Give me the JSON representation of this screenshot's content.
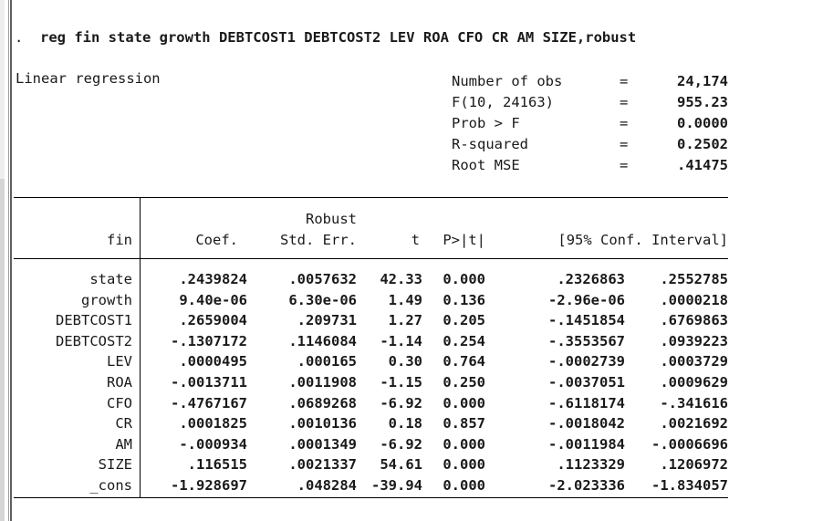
{
  "command": {
    "prompt": ".",
    "text": "reg fin state growth DEBTCOST1 DEBTCOST2 LEV ROA CFO CR AM SIZE,robust"
  },
  "model": {
    "type_label": "Linear regression"
  },
  "stats": [
    {
      "label": "Number of obs",
      "eq": "=",
      "value": "24,174"
    },
    {
      "label": "F(10, 24163)",
      "eq": "=",
      "value": "955.23"
    },
    {
      "label": "Prob > F",
      "eq": "=",
      "value": "0.0000"
    },
    {
      "label": "R-squared",
      "eq": "=",
      "value": "0.2502"
    },
    {
      "label": "Root MSE",
      "eq": "=",
      "value": ".41475"
    }
  ],
  "table": {
    "supheader": "Robust",
    "headers": {
      "dependent": "fin",
      "coef": "Coef.",
      "std_err": "Std. Err.",
      "t": "t",
      "p": "P>|t|",
      "conf_int": "[95% Conf. Interval]"
    },
    "rows": [
      {
        "name": "state",
        "coef": ".2439824",
        "se": ".0057632",
        "t": "42.33",
        "p": "0.000",
        "ci_low": ".2326863",
        "ci_high": ".2552785"
      },
      {
        "name": "growth",
        "coef": "9.40e-06",
        "se": "6.30e-06",
        "t": "1.49",
        "p": "0.136",
        "ci_low": "-2.96e-06",
        "ci_high": ".0000218"
      },
      {
        "name": "DEBTCOST1",
        "coef": ".2659004",
        "se": ".209731",
        "t": "1.27",
        "p": "0.205",
        "ci_low": "-.1451854",
        "ci_high": ".6769863"
      },
      {
        "name": "DEBTCOST2",
        "coef": "-.1307172",
        "se": ".1146084",
        "t": "-1.14",
        "p": "0.254",
        "ci_low": "-.3553567",
        "ci_high": ".0939223"
      },
      {
        "name": "LEV",
        "coef": ".0000495",
        "se": ".000165",
        "t": "0.30",
        "p": "0.764",
        "ci_low": "-.0002739",
        "ci_high": ".0003729"
      },
      {
        "name": "ROA",
        "coef": "-.0013711",
        "se": ".0011908",
        "t": "-1.15",
        "p": "0.250",
        "ci_low": "-.0037051",
        "ci_high": ".0009629"
      },
      {
        "name": "CFO",
        "coef": "-.4767167",
        "se": ".0689268",
        "t": "-6.92",
        "p": "0.000",
        "ci_low": "-.6118174",
        "ci_high": "-.341616"
      },
      {
        "name": "CR",
        "coef": ".0001825",
        "se": ".0010136",
        "t": "0.18",
        "p": "0.857",
        "ci_low": "-.0018042",
        "ci_high": ".0021692"
      },
      {
        "name": "AM",
        "coef": "-.000934",
        "se": ".0001349",
        "t": "-6.92",
        "p": "0.000",
        "ci_low": "-.0011984",
        "ci_high": "-.0006696"
      },
      {
        "name": "SIZE",
        "coef": ".116515",
        "se": ".0021337",
        "t": "54.61",
        "p": "0.000",
        "ci_low": ".1123329",
        "ci_high": ".1206972"
      },
      {
        "name": "_cons",
        "coef": "-1.928697",
        "se": ".048284",
        "t": "-39.94",
        "p": "0.000",
        "ci_low": "-2.023336",
        "ci_high": "-1.834057"
      }
    ]
  }
}
